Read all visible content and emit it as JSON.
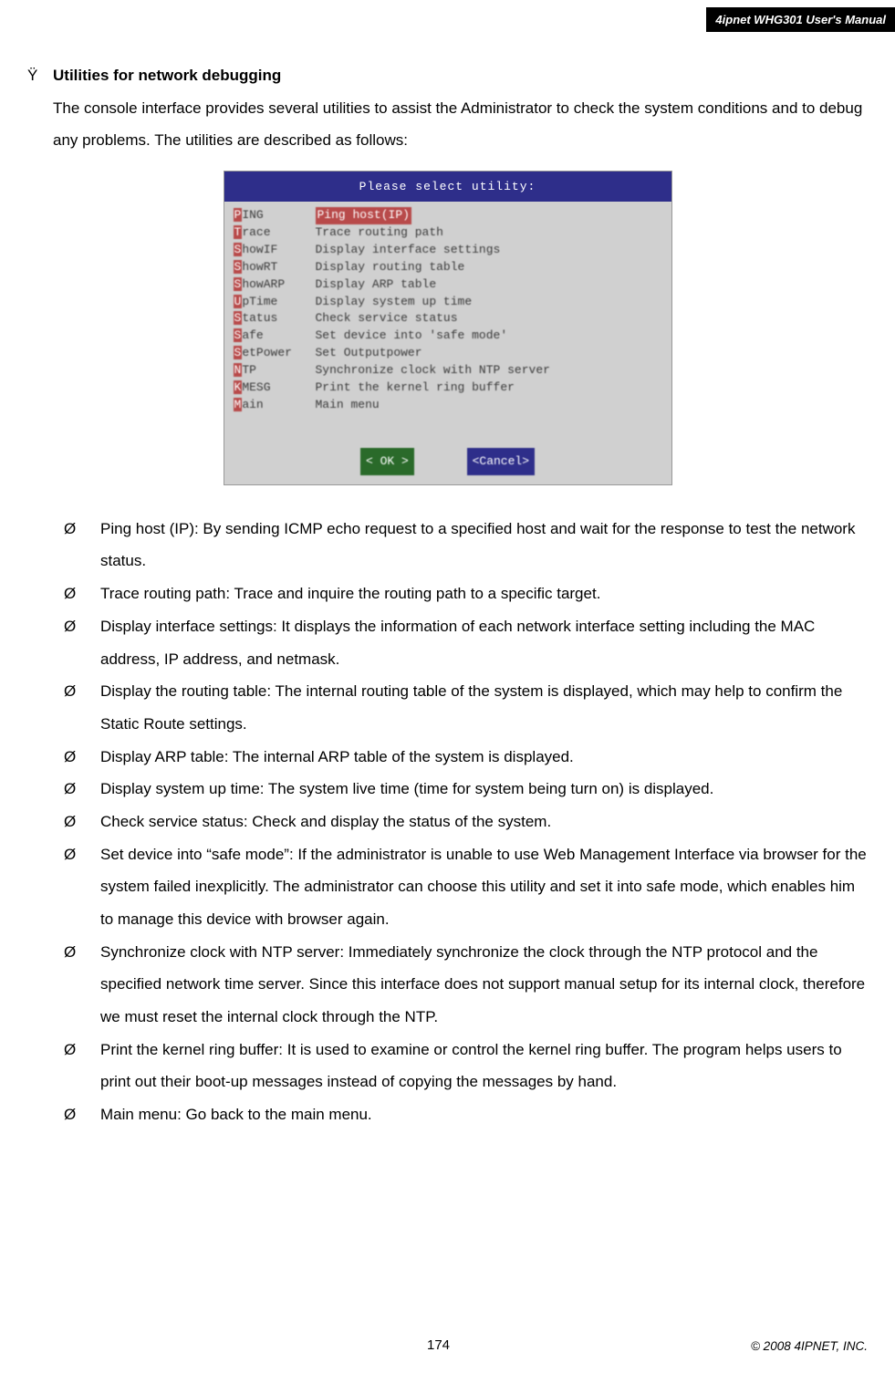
{
  "header": {
    "manual_title": "4ipnet WHG301 User's Manual"
  },
  "section": {
    "bullet_marker": "Ÿ",
    "title": "Utilities for network debugging",
    "intro": "The console interface provides several utilities to assist the Administrator to check the system conditions and to debug any problems. The utilities are described as follows:"
  },
  "console": {
    "header": "Please select utility:",
    "rows": [
      {
        "cmd_hl": "P",
        "cmd_rest": "ING",
        "desc": "Ping host(IP)",
        "selected": true
      },
      {
        "cmd_hl": "T",
        "cmd_rest": "race",
        "desc": "Trace routing path"
      },
      {
        "cmd_hl": "S",
        "cmd_rest": "howIF",
        "desc": "Display interface settings"
      },
      {
        "cmd_hl": "S",
        "cmd_rest": "howRT",
        "desc": "Display routing table"
      },
      {
        "cmd_hl": "S",
        "cmd_rest": "howARP",
        "desc": "Display ARP table"
      },
      {
        "cmd_hl": "U",
        "cmd_rest": "pTime",
        "desc": "Display system up time"
      },
      {
        "cmd_hl": "S",
        "cmd_rest": "tatus",
        "desc": "Check service status"
      },
      {
        "cmd_hl": "S",
        "cmd_rest": "afe",
        "desc": "Set device into 'safe mode'"
      },
      {
        "cmd_hl": "S",
        "cmd_rest": "etPower",
        "desc": "Set Outputpower"
      },
      {
        "cmd_hl": "N",
        "cmd_rest": "TP",
        "desc": "Synchronize clock with NTP server"
      },
      {
        "cmd_hl": "K",
        "cmd_rest": "MESG",
        "desc": "Print the kernel ring buffer"
      },
      {
        "cmd_hl": "M",
        "cmd_rest": "ain",
        "desc": "Main menu"
      }
    ],
    "ok_label": "<  OK  >",
    "cancel_label": "<Cancel>"
  },
  "items": [
    "Ping host (IP): By sending ICMP echo request to a specified host and wait for the response to test the network status.",
    "Trace routing path: Trace and inquire the routing path to a specific target.",
    "Display interface settings: It displays the information of each network interface setting including the MAC address, IP address, and netmask.",
    "Display the routing table: The internal routing table of the system is displayed, which may help to confirm the Static Route settings.",
    "Display ARP table: The internal ARP table of the system is displayed.",
    "Display system up time: The system live time (time for system being turn on) is displayed.",
    "Check service status: Check and display the status of the system.",
    "Set device into “safe mode”: If the administrator is unable to use Web Management Interface via browser for the system failed inexplicitly. The administrator can choose this utility and set it into safe mode, which enables him to manage this device with browser again.",
    "Synchronize clock with NTP server: Immediately synchronize the clock through the NTP protocol and the specified network time server. Since this interface does not support manual setup for its internal clock, therefore we must reset the internal clock through the NTP.",
    "Print the kernel ring buffer: It is used to examine or control the kernel ring buffer. The program helps users to print out their boot-up messages instead of copying the messages by hand.",
    "Main menu: Go back to the main menu."
  ],
  "sub_marker": "Ø",
  "footer": {
    "page_number": "174",
    "copyright": "© 2008 4IPNET, INC."
  }
}
